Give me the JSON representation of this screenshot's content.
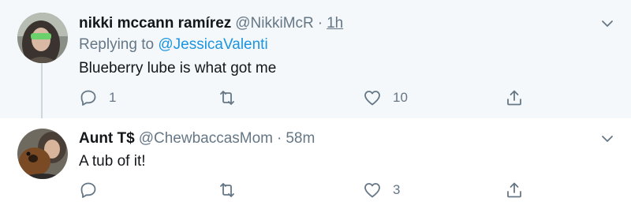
{
  "tweets": [
    {
      "name": "nikki mccann ramírez",
      "handle": "@NikkiMcR",
      "separator": "·",
      "time": "1h",
      "reply_prefix": "Replying to",
      "reply_mention": "@JessicaValenti",
      "text": "Blueberry lube is what got me",
      "reply_count": "1",
      "retweet_count": "",
      "like_count": "10"
    },
    {
      "name": "Aunt T$",
      "handle": "@ChewbaccasMom",
      "separator": "·",
      "time": "58m",
      "text": "A tub of it!",
      "reply_count": "",
      "retweet_count": "",
      "like_count": "3"
    }
  ],
  "colors": {
    "text": "#14171a",
    "secondary": "#657786",
    "link": "#1b95e0",
    "thread_line": "#ccd6dd",
    "bg_highlight": "#f5f8fa",
    "bg": "#ffffff"
  },
  "icons": [
    "reply-icon",
    "retweet-icon",
    "like-icon",
    "share-icon",
    "chevron-down-icon"
  ]
}
